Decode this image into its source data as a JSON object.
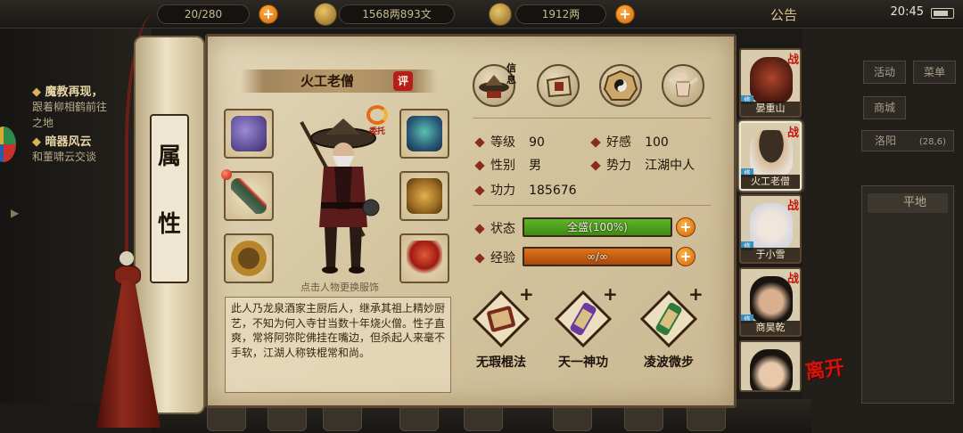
{
  "topbar": {
    "stamina": "20/280",
    "copper": "1568两893文",
    "silver": "1912两",
    "announcement": "公告",
    "clock": "20:45"
  },
  "quests": [
    {
      "title": "魔教再现，",
      "lines": [
        "跟着柳相鹤前往",
        "之地"
      ]
    },
    {
      "title": "暗器风云",
      "lines": [
        "和董啸云交谈"
      ]
    }
  ],
  "scroll": {
    "label_line1": "属",
    "label_line2": "性"
  },
  "character": {
    "name": "火工老僧",
    "rate_badge": "评",
    "entrust_label": "委托",
    "hint": "点击人物更换服饰",
    "bio": "此人乃龙泉酒家主厨后人，继承其祖上精妙厨艺，不知为何入寺甘当数十年烧火僧。性子直爽，常将阿弥陀佛挂在嘴边，但杀起人来毫不手软，江湖人称铁棍常和尚。"
  },
  "tabs": {
    "info_label": "信息"
  },
  "stats": {
    "level_label": "等级",
    "level_value": "90",
    "favor_label": "好感",
    "favor_value": "100",
    "gender_label": "性别",
    "gender_value": "男",
    "faction_label": "势力",
    "faction_value": "江湖中人",
    "power_label": "功力",
    "power_value": "185676",
    "status_label": "状态",
    "status_text": "全盛(100%)",
    "status_fraction": 1.0,
    "exp_label": "经验",
    "exp_text": "∞/∞",
    "exp_fraction": 1.0
  },
  "skills": [
    {
      "name": "无瑕棍法"
    },
    {
      "name": "天一神功"
    },
    {
      "name": "凌波微步"
    }
  ],
  "roster": [
    {
      "name": "晏重山",
      "battle": "战",
      "active": false
    },
    {
      "name": "火工老僧",
      "battle": "战",
      "active": true
    },
    {
      "name": "于小雪",
      "battle": "战",
      "active": false
    },
    {
      "name": "商昊乾",
      "battle": "战",
      "active": false
    },
    {
      "name": "",
      "battle": "",
      "active": false
    }
  ],
  "right_panel": {
    "activity": "活动",
    "menu": "菜单",
    "shop": "商城",
    "location": "洛阳",
    "location_coords": "(28,6)",
    "terrain": "平地"
  },
  "leave_button": "离开",
  "colors": {
    "status_bar": "#5fb52a",
    "exp_bar": "#e0751a",
    "accent_red": "#b51e1a"
  }
}
